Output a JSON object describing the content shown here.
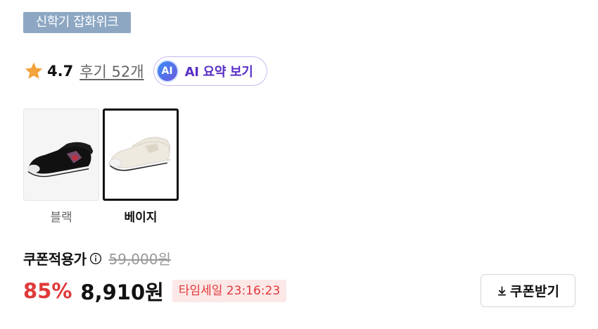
{
  "tag": {
    "label": "신학기 잡화위크"
  },
  "rating": {
    "value": "4.7",
    "review_link": "후기 52개",
    "ai_badge": "AI",
    "ai_button_label": "AI 요약 보기"
  },
  "options": [
    {
      "label": "블랙",
      "selected": false
    },
    {
      "label": "베이지",
      "selected": true
    }
  ],
  "price": {
    "label": "쿠폰적용가",
    "original": "59,000원",
    "discount": "85%",
    "final": "8,910원",
    "timer": "타임세일 23:16:23"
  },
  "coupon": {
    "label": "쿠폰받기"
  },
  "colors": {
    "accent_red": "#e03a3a",
    "tag_bg": "#8da7c3",
    "ai_purple": "#5a2fc4"
  }
}
